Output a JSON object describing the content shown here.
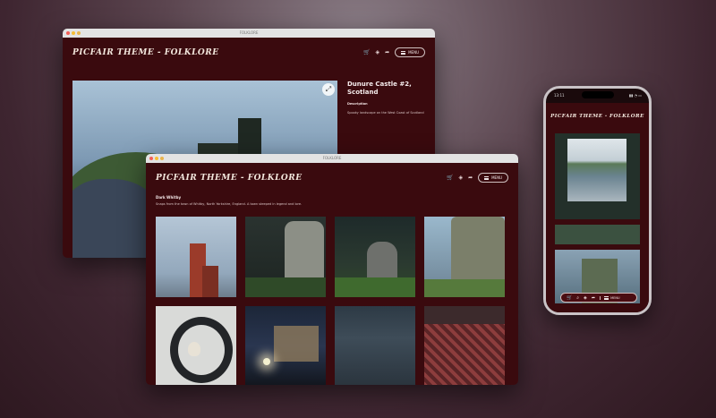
{
  "back_window": {
    "title": "FOLKLORE",
    "logo": "PICFAIR THEME - FOLKLORE",
    "menu_label": "MENU",
    "image_title": "Dunure Castle #2, Scotland",
    "description_heading": "Description",
    "description_text": "Spooky landscape on the West Coast of Scotland"
  },
  "front_window": {
    "title": "FOLKLORE",
    "logo": "PICFAIR THEME - FOLKLORE",
    "menu_label": "MENU",
    "album_title": "Dark Whitby",
    "album_subtitle": "Snaps from the town of Whitby, North Yorkshire, England. A town steeped in legend and lore."
  },
  "phone": {
    "time": "13:11",
    "logo": "PICFAIR THEME - FOLKLORE",
    "menu_label": "MENU"
  },
  "icons": {
    "cart": "cart-icon",
    "tags": "tag-icon",
    "share": "share-icon",
    "menu": "hamburger-icon",
    "fullscreen": "fullscreen-icon",
    "search": "search-icon"
  },
  "colors": {
    "app_background": "#3a0a0e",
    "text_light": "#f2e6dc"
  }
}
